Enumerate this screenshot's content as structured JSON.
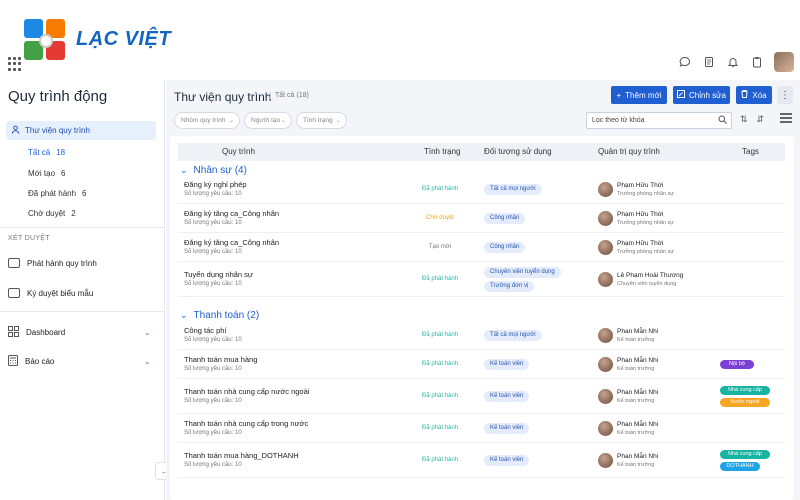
{
  "brand": {
    "name": "LẠC VIỆT"
  },
  "sidebar": {
    "title": "Quy trình động",
    "active_item": "Thư viện quy trình",
    "subitems": [
      {
        "label": "Tất cả",
        "count": "18"
      },
      {
        "label": "Mới tạo",
        "count": "6"
      },
      {
        "label": "Đã phát hành",
        "count": "6"
      },
      {
        "label": "Chờ duyệt",
        "count": "2"
      }
    ],
    "section_label": "XÉT DUYỆT",
    "approval_items": [
      "Phát hành quy trình",
      "Ký duyệt biểu mẫu"
    ],
    "bottom_items": [
      "Dashboard",
      "Báo cáo"
    ]
  },
  "main": {
    "title": "Thư viện quy trình",
    "subtitle": "Tất cả  (18)",
    "buttons": {
      "add": "Thêm mới",
      "edit": "Chỉnh sửa",
      "delete": "Xóa"
    },
    "filters": [
      "Nhóm quy trình",
      "Người tạo",
      "Tình trạng"
    ],
    "search_placeholder": "Lọc theo từ khóa"
  },
  "table": {
    "headers": {
      "process": "Quy trình",
      "status": "Tình trạng",
      "audience": "Đối tượng sử dụng",
      "admin": "Quản trị quy trình",
      "tags": "Tags"
    },
    "groups": [
      {
        "title": "Nhân sự (4)",
        "rows": [
          {
            "name": "Đăng ký nghỉ phép",
            "sub": "Số lượng yêu cầu: 10",
            "status": "Đã phát hành",
            "audience": [
              "Tất cả mọi người"
            ],
            "admin_name": "Phạm Hữu Thời",
            "admin_role": "Trưởng phòng nhân sự",
            "tags": []
          },
          {
            "name": "Đăng ký tăng ca_Công nhân",
            "sub": "Số lượng yêu cầu: 10",
            "status": "Chờ duyệt",
            "audience": [
              "Công nhân"
            ],
            "admin_name": "Phạm Hữu Thời",
            "admin_role": "Trưởng phòng nhân sự",
            "tags": []
          },
          {
            "name": "Đăng ký tăng ca_Công nhân",
            "sub": "Số lượng yêu cầu: 10",
            "status": "Tạo mới",
            "audience": [
              "Công nhân"
            ],
            "admin_name": "Phạm Hữu Thời",
            "admin_role": "Trưởng phòng nhân sự",
            "tags": []
          },
          {
            "name": "Tuyển dụng nhân sự",
            "sub": "Số lượng yêu cầu: 10",
            "status": "Đã phát hành",
            "audience": [
              "Chuyên viên tuyển dụng",
              "Trưởng đơn vị"
            ],
            "admin_name": "Lê Phạm Hoài Thương",
            "admin_role": "Chuyên viên tuyển dụng",
            "tags": []
          }
        ]
      },
      {
        "title": "Thanh toán (2)",
        "rows": [
          {
            "name": "Công tác phí",
            "sub": "Số lượng yêu cầu: 10",
            "status": "Đã phát hành",
            "audience": [
              "Tất cả mọi người"
            ],
            "admin_name": "Phan Mẫn Nhi",
            "admin_role": "Kế toán trưởng",
            "tags": []
          },
          {
            "name": "Thanh toán mua hàng",
            "sub": "Số lượng yêu cầu: 10",
            "status": "Đã phát hành",
            "audience": [
              "Kế toán viên"
            ],
            "admin_name": "Phan Mẫn Nhi",
            "admin_role": "Kế toán trưởng",
            "tags": [
              "Nội bộ"
            ]
          },
          {
            "name": "Thanh toán nhà cung cấp nước ngoài",
            "sub": "Số lượng yêu cầu: 10",
            "status": "Đã phát hành",
            "audience": [
              "Kế toán viên"
            ],
            "admin_name": "Phan Mẫn Nhi",
            "admin_role": "Kế toán trưởng",
            "tags": [
              "Nhà cung cấp",
              "Nước ngoài"
            ]
          },
          {
            "name": "Thanh toán nhà cung cấp trong nước",
            "sub": "Số lượng yêu cầu: 10",
            "status": "Đã phát hành",
            "audience": [
              "Kế toán viên"
            ],
            "admin_name": "Phan Mẫn Nhi",
            "admin_role": "Kế toán trưởng",
            "tags": []
          },
          {
            "name": "Thanh toán mua hàng_DOTHANH",
            "sub": "Số lượng yêu cầu: 10",
            "status": "Đã phát hành",
            "audience": [
              "Kế toán viên"
            ],
            "admin_name": "Phan Mẫn Nhi",
            "admin_role": "Kế toán trưởng",
            "tags": [
              "Nhà cung cấp",
              "DOTHANH"
            ]
          }
        ]
      }
    ]
  },
  "colors": {
    "primary": "#1f5fd1",
    "status_published": "#2bb3a3",
    "status_pending": "#e6a817",
    "status_new": "#777777",
    "tag_internal": "#7b3fd6",
    "tag_supplier": "#17b3a3",
    "tag_foreign": "#f5a623",
    "tag_dothanh": "#1fa3e6"
  }
}
